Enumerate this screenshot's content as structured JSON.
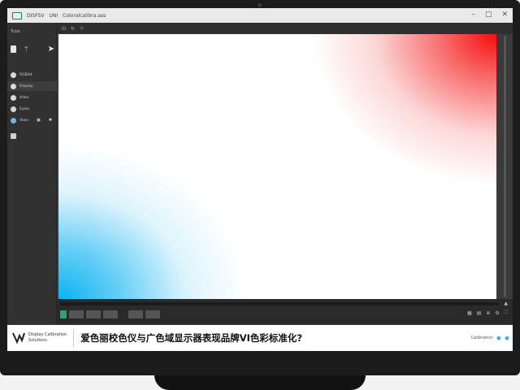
{
  "titlebar": {
    "app_name": "DISFSV",
    "menu": "UNI",
    "subtitle": "Coloralcalibra.ass",
    "controls": [
      "–",
      "□",
      "✕"
    ]
  },
  "sidebar": {
    "label": "Tube",
    "items": [
      {
        "label": "RGBA4",
        "active": true
      },
      {
        "label": "Display",
        "active": true
      },
      {
        "label": "Adeo",
        "active": false
      },
      {
        "label": "Eyaw",
        "active": false
      },
      {
        "label": "Vkeu",
        "active": false
      }
    ]
  },
  "toolbar": {
    "icons": [
      "crop-icon",
      "refresh-icon",
      "sun-icon"
    ]
  },
  "banner": {
    "logo_line1": "Display Calibration",
    "logo_line2": "Solutions",
    "headline": "爱色丽校色仪与广色域显示器表现品牌VI色彩标准化?",
    "right_text": "Calibration"
  },
  "colors": {
    "accent_green": "#2aa36f",
    "gradient_red": "#f60c0c",
    "gradient_blue": "#00aef0"
  }
}
